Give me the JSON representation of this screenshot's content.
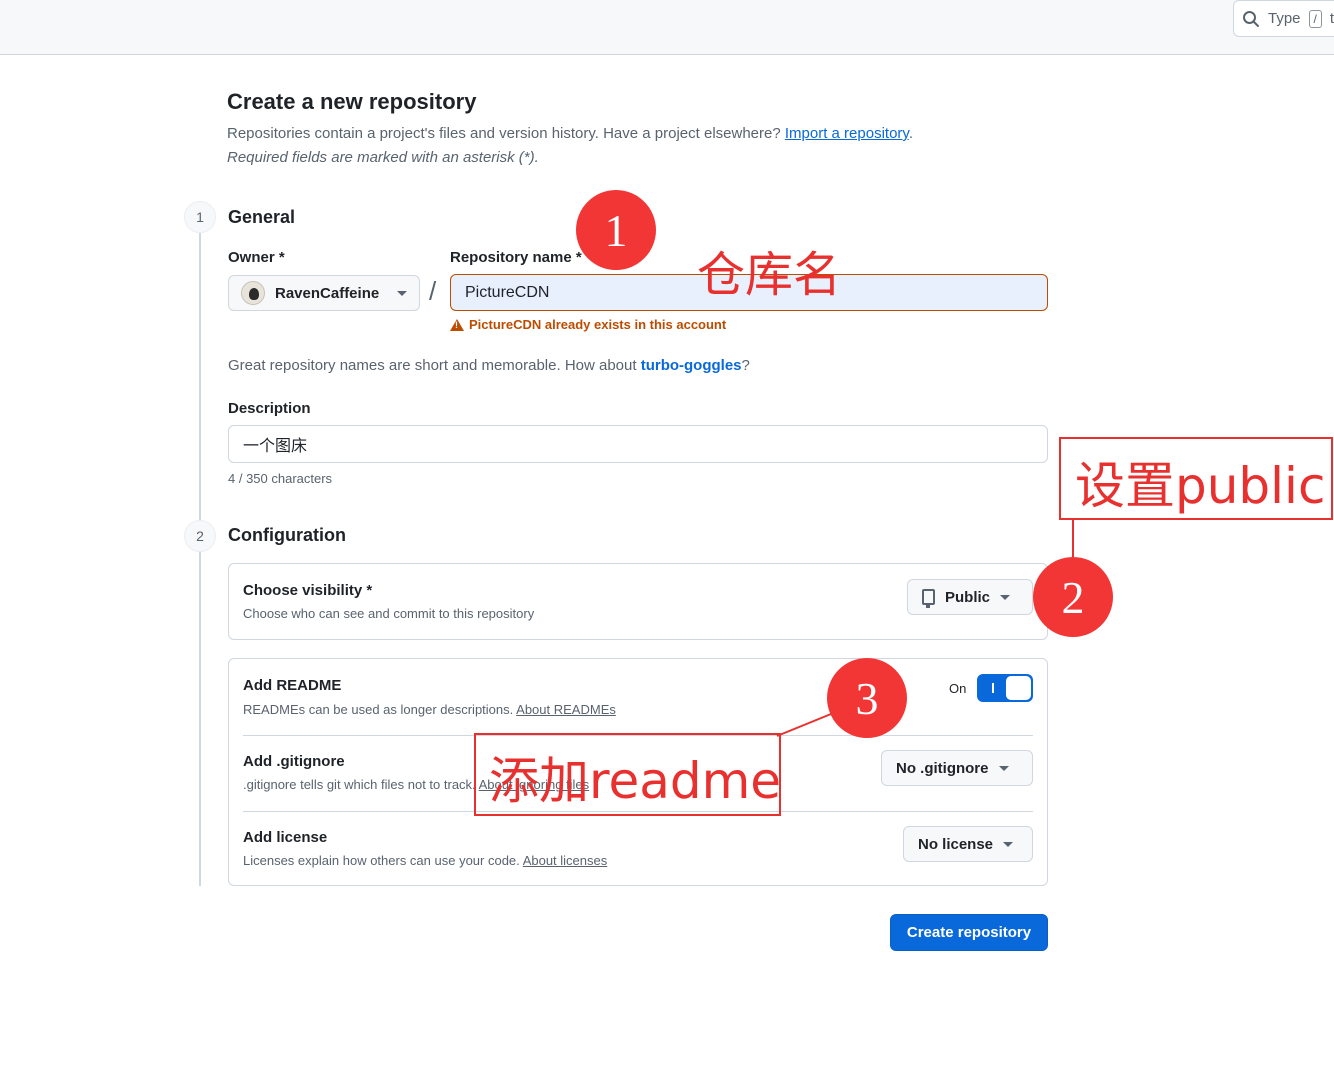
{
  "header": {
    "search_placeholder": "Type",
    "search_shortcut": "/",
    "search_trailing": "t"
  },
  "page": {
    "title": "Create a new repository",
    "intro": "Repositories contain a project's files and version history. Have a project elsewhere?",
    "import_link": "Import a repository",
    "intro_end": ".",
    "required_note": "Required fields are marked with an asterisk (*)."
  },
  "general": {
    "step": "1",
    "title": "General",
    "owner_label": "Owner *",
    "owner_value": "RavenCaffeine",
    "slash": "/",
    "repo_label": "Repository name *",
    "repo_value": "PictureCDN",
    "repo_error": "PictureCDN already exists in this account",
    "suggest_prefix": "Great repository names are short and memorable. How about ",
    "suggest_name": "turbo-goggles",
    "suggest_suffix": "?",
    "description_label": "Description",
    "description_value": "一个图床",
    "description_counter": "4 / 350 characters"
  },
  "configuration": {
    "step": "2",
    "title": "Configuration",
    "visibility_title": "Choose visibility *",
    "visibility_sub": "Choose who can see and commit to this repository",
    "visibility_value": "Public",
    "readme_title": "Add README",
    "readme_sub": "READMEs can be used as longer descriptions.",
    "readme_link": "About READMEs",
    "readme_toggle_label": "On",
    "readme_on": true,
    "gitignore_title": "Add .gitignore",
    "gitignore_sub": ".gitignore tells git which files not to track.",
    "gitignore_link": "About ignoring files",
    "gitignore_value": "No .gitignore",
    "license_title": "Add license",
    "license_sub": "Licenses explain how others can use your code.",
    "license_link": "About licenses",
    "license_value": "No license"
  },
  "actions": {
    "create_label": "Create repository"
  },
  "annotations": {
    "circle_1": "1",
    "label_1": "仓库名",
    "circle_2": "2",
    "label_2": "设置public",
    "circle_3": "3",
    "label_3": "添加readme",
    "color": "#e8302f"
  },
  "colors": {
    "accent": "#0969da",
    "error": "#bc4c00",
    "annotation": "#f23535"
  }
}
